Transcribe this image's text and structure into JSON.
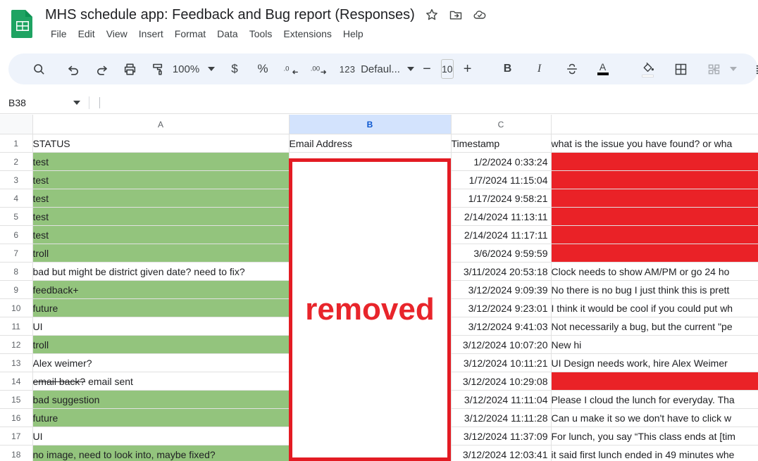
{
  "app": {
    "logo_name": "google-sheets-logo",
    "doc_title": "MHS schedule app: Feedback and Bug report (Responses)",
    "title_icons": [
      {
        "name": "star-icon",
        "label": "Star"
      },
      {
        "name": "move-to-folder-icon",
        "label": "Move"
      },
      {
        "name": "cloud-saved-icon",
        "label": "Saved to Drive"
      }
    ],
    "menus": [
      "File",
      "Edit",
      "View",
      "Insert",
      "Format",
      "Data",
      "Tools",
      "Extensions",
      "Help"
    ]
  },
  "toolbar": {
    "search_label": "search-icon",
    "undo_label": "undo-icon",
    "redo_label": "redo-icon",
    "print_label": "print-icon",
    "paint_label": "paint-format-icon",
    "zoom_value": "100%",
    "currency_label": "$",
    "percent_label": "%",
    "decrease_decimal_label": ".0",
    "increase_decimal_label": ".00",
    "more_formats_label": "123",
    "font_name": "Defaul...",
    "font_decrease_label": "−",
    "font_size": "10",
    "font_increase_label": "+",
    "bold_label": "B",
    "italic_label": "I",
    "strikethrough_label": "strikethrough-icon",
    "text_color_label": "A",
    "fill_color_label": "fill-color-icon",
    "borders_label": "borders-icon",
    "merge_label": "merge-cells-icon",
    "align_label": "horizontal-align-icon"
  },
  "formula_bar": {
    "name_box": "B38",
    "formula_value": ""
  },
  "grid": {
    "columns": [
      {
        "id": "A",
        "label": "A",
        "selected": false
      },
      {
        "id": "B",
        "label": "B",
        "selected": true
      },
      {
        "id": "C",
        "label": "C",
        "selected": false
      },
      {
        "id": "D",
        "label": "",
        "selected": false
      }
    ],
    "headers": {
      "row": "1",
      "a": "STATUS",
      "b": "Email Address",
      "c": "Timestamp",
      "d": "what is the issue you have found? or wha"
    },
    "rows": [
      {
        "n": "2",
        "a": "test",
        "a_green": true,
        "a_strike": "",
        "c": "1/2/2024 0:33:24",
        "d": "",
        "d_redacted": true
      },
      {
        "n": "3",
        "a": "test",
        "a_green": true,
        "a_strike": "",
        "c": "1/7/2024 11:15:04",
        "d": "",
        "d_redacted": true
      },
      {
        "n": "4",
        "a": "test",
        "a_green": true,
        "a_strike": "",
        "c": "1/17/2024 9:58:21",
        "d": "",
        "d_redacted": true
      },
      {
        "n": "5",
        "a": "test",
        "a_green": true,
        "a_strike": "",
        "c": "2/14/2024 11:13:11",
        "d": "",
        "d_redacted": true
      },
      {
        "n": "6",
        "a": "test",
        "a_green": true,
        "a_strike": "",
        "c": "2/14/2024 11:17:11",
        "d": "",
        "d_redacted": true
      },
      {
        "n": "7",
        "a": "troll",
        "a_green": true,
        "a_strike": "",
        "c": "3/6/2024 9:59:59",
        "d": "",
        "d_redacted": true
      },
      {
        "n": "8",
        "a": "bad but might be district given date? need to fix?",
        "a_green": false,
        "a_strike": "",
        "c": "3/11/2024 20:53:18",
        "d": "Clock needs to show AM/PM or go 24 ho",
        "d_redacted": false
      },
      {
        "n": "9",
        "a": "feedback+",
        "a_green": true,
        "a_strike": "",
        "c": "3/12/2024 9:09:39",
        "d": "No there is no bug I just think this is prett",
        "d_redacted": false
      },
      {
        "n": "10",
        "a": "future",
        "a_green": true,
        "a_strike": "",
        "c": "3/12/2024 9:23:01",
        "d": "I think it would be cool if you could put wh",
        "d_redacted": false
      },
      {
        "n": "11",
        "a": "UI",
        "a_green": false,
        "a_strike": "",
        "c": "3/12/2024 9:41:03",
        "d": "Not necessarily a bug, but the current \"pe",
        "d_redacted": false
      },
      {
        "n": "12",
        "a": "troll",
        "a_green": true,
        "a_strike": "",
        "c": "3/12/2024 10:07:20",
        "d": "New hi",
        "d_redacted": false
      },
      {
        "n": "13",
        "a": "Alex weimer?",
        "a_green": false,
        "a_strike": "",
        "c": "3/12/2024 10:11:21",
        "d": "UI Design needs work, hire Alex Weimer",
        "d_redacted": false
      },
      {
        "n": "14",
        "a": " email sent",
        "a_green": false,
        "a_strike": "email back?",
        "c": "3/12/2024 10:29:08",
        "d": "",
        "d_redacted": true
      },
      {
        "n": "15",
        "a": "bad suggestion",
        "a_green": true,
        "a_strike": "",
        "c": "3/12/2024 11:11:04",
        "d": "Please I cloud the lunch for everyday. Tha",
        "d_redacted": false
      },
      {
        "n": "16",
        "a": "future",
        "a_green": true,
        "a_strike": "",
        "c": "3/12/2024 11:11:28",
        "d": "Can u make it so we don't have to click w",
        "d_redacted": false
      },
      {
        "n": "17",
        "a": "UI",
        "a_green": false,
        "a_strike": "",
        "c": "3/12/2024 11:37:09",
        "d": "For lunch, you say “This class ends at [tim",
        "d_redacted": false
      },
      {
        "n": "18",
        "a": "no image, need to look into, maybe fixed?",
        "a_green": true,
        "a_strike": "",
        "c": "3/12/2024 12:03:41",
        "d": "it said first lunch ended in 49 minutes whe",
        "d_redacted": false
      }
    ]
  },
  "redaction": {
    "label": "removed",
    "border_color": "#e31b23",
    "text_color": "#e8252b"
  },
  "colors": {
    "green_fill": "#93c47d",
    "red_fill": "#ea2227",
    "selected_header": "#d3e3fd",
    "brand_green": "#188038"
  }
}
